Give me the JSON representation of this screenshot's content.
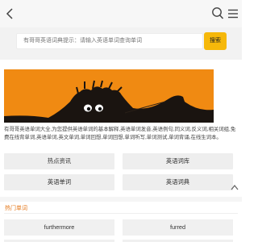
{
  "header": {
    "icons": [
      "back-icon",
      "search-icon",
      "menu-icon"
    ]
  },
  "search": {
    "placeholder": "有哥哥英语词典提示：请输入英语单词查询单词",
    "button_label": "搜索"
  },
  "intro": {
    "text": "有哥哥英语单词大全,为您提供英语单词的基本解释,英语单词发音,英语例句,同义词,反义词,相关词组,免费在线背单词,英语单词,英文单词,单词回想,单词回想,单词听写,单词测试,单词背诵,在线生词本。"
  },
  "links": [
    {
      "label": "热点资讯"
    },
    {
      "label": "英语词库"
    },
    {
      "label": "英语单词"
    },
    {
      "label": "英语词典"
    }
  ],
  "hot": {
    "title": "热门单词",
    "words": [
      {
        "label": "furthermore"
      },
      {
        "label": "furred"
      }
    ]
  },
  "colors": {
    "accent": "#f6b80a",
    "banner": "#f08a12",
    "section_title": "#e57a1e"
  }
}
